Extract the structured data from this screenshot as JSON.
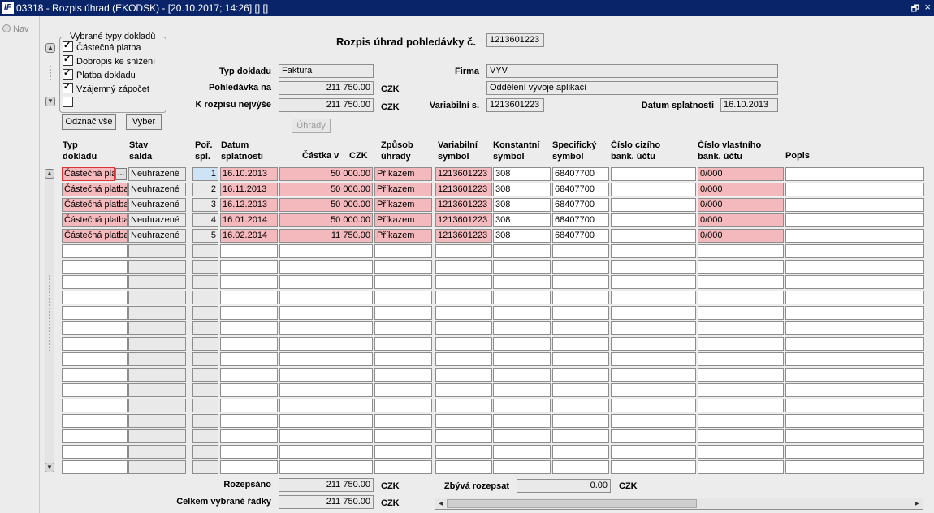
{
  "window": {
    "title": "03318 - Rozpis úhrad (EKODSK) - [20.10.2017; 14:26] [] []",
    "app_icon": "IF",
    "restore_glyph": "🗗",
    "close_glyph": "×"
  },
  "nav": {
    "label": "Nav"
  },
  "filter": {
    "legend": "Vybrané typy dokladů",
    "items": [
      {
        "label": "Částečná platba",
        "checked": true
      },
      {
        "label": "Dobropis ke snížení",
        "checked": true
      },
      {
        "label": "Platba dokladu",
        "checked": true
      },
      {
        "label": "Vzájemný zápočet",
        "checked": true
      },
      {
        "label": "",
        "checked": false
      }
    ],
    "unmark_all_label": "Odznač vše",
    "select_label": "Vyber"
  },
  "header": {
    "title": "Rozpis úhrad pohledávky č.",
    "claim_no": "1213601223",
    "doc_type_label": "Typ dokladu",
    "doc_type": "Faktura",
    "claim_label": "Pohledávka na",
    "claim_amount": "211 750.00",
    "claim_currency": "CZK",
    "max_label": "K rozpisu nejvýše",
    "max_amount": "211 750.00",
    "max_currency": "CZK",
    "company_label": "Firma",
    "company": "VYV",
    "department": "Oddělení vývoje aplikací",
    "varsym_label": "Variabilní s.",
    "varsym": "1213601223",
    "due_label": "Datum splatnosti",
    "due": "16.10.2013",
    "payments_button": "Úhrady"
  },
  "table": {
    "columns": {
      "typ": "Typ\ndokladu",
      "stav": "Stav\nsalda",
      "por": "Poř.\nspl.",
      "datum": "Datum\nsplatnosti",
      "castka": "Částka v",
      "castka_cur": "CZK",
      "zpusob": "Způsob\núhrady",
      "vs": "Variabilní\nsymbol",
      "ks": "Konstantní\nsymbol",
      "ss": "Specifický\nsymbol",
      "cizi": "Číslo cizího\nbank. účtu",
      "vlastni": "Číslo vlastního\nbank. účtu",
      "popis": "Popis"
    },
    "rows": [
      {
        "typ": "Částečná platba",
        "stav": "Neuhrazené",
        "por": "1",
        "datum": "16.10.2013",
        "castka": "50 000.00",
        "zpusob": "Příkazem",
        "vs": "1213601223",
        "ks": "308",
        "ss": "68407700",
        "cizi": "",
        "vlastni": "0/000",
        "popis": ""
      },
      {
        "typ": "Částečná platba",
        "stav": "Neuhrazené",
        "por": "2",
        "datum": "16.11.2013",
        "castka": "50 000.00",
        "zpusob": "Příkazem",
        "vs": "1213601223",
        "ks": "308",
        "ss": "68407700",
        "cizi": "",
        "vlastni": "0/000",
        "popis": ""
      },
      {
        "typ": "Částečná platba",
        "stav": "Neuhrazené",
        "por": "3",
        "datum": "16.12.2013",
        "castka": "50 000.00",
        "zpusob": "Příkazem",
        "vs": "1213601223",
        "ks": "308",
        "ss": "68407700",
        "cizi": "",
        "vlastni": "0/000",
        "popis": ""
      },
      {
        "typ": "Částečná platba",
        "stav": "Neuhrazené",
        "por": "4",
        "datum": "16.01.2014",
        "castka": "50 000.00",
        "zpusob": "Příkazem",
        "vs": "1213601223",
        "ks": "308",
        "ss": "68407700",
        "cizi": "",
        "vlastni": "0/000",
        "popis": ""
      },
      {
        "typ": "Částečná platba",
        "stav": "Neuhrazené",
        "por": "5",
        "datum": "16.02.2014",
        "castka": "11 750.00",
        "zpusob": "Příkazem",
        "vs": "1213601223",
        "ks": "308",
        "ss": "68407700",
        "cizi": "",
        "vlastni": "0/000",
        "popis": ""
      }
    ],
    "empty_rows": 15,
    "ellipsis": "...",
    "up_glyph": "▲",
    "down_glyph": "▼"
  },
  "footer": {
    "allocated_label": "Rozepsáno",
    "allocated": "211 750.00",
    "allocated_currency": "CZK",
    "selected_label": "Celkem vybrané řádky",
    "selected": "211 750.00",
    "selected_currency": "CZK",
    "remaining_label": "Zbývá rozepsat",
    "remaining": "0.00",
    "remaining_currency": "CZK",
    "left_glyph": "◄",
    "right_glyph": "►"
  }
}
